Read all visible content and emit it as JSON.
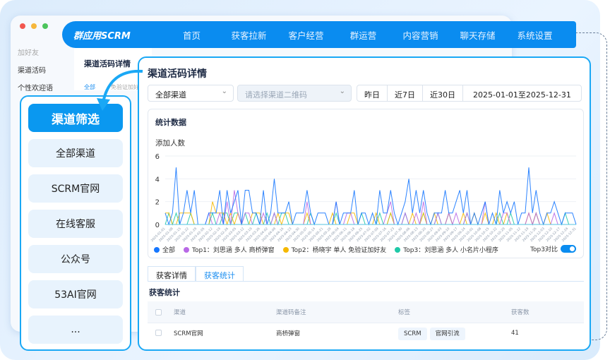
{
  "nav": {
    "logo": "群应用SCRM",
    "items": [
      "首页",
      "获客拉新",
      "客户经营",
      "群运营",
      "内容营销",
      "聊天存储",
      "系统设置"
    ]
  },
  "back": {
    "sidebar": [
      "加好友",
      "渠道活码",
      "个性欢迎语"
    ],
    "title": "渠道活码详情",
    "tab": "全部",
    "snippet": "免验证加好友"
  },
  "left_panel": {
    "items": [
      "渠道筛选",
      "全部渠道",
      "SCRM官网",
      "在线客服",
      "公众号",
      "53AI官网",
      "..."
    ]
  },
  "main": {
    "title": "渠道活码详情",
    "channel_select": "全部渠道",
    "qr_placeholder": "请选择渠道二维码",
    "quick_ranges": [
      "昨日",
      "近7日",
      "近30日"
    ],
    "date_range": "2025-01-01至2025-12-31",
    "card_title": "统计数据",
    "toggle_label": "Top3对比",
    "toggle_on": true,
    "tabs": [
      "获客详情",
      "获客统计"
    ],
    "active_tab": 1,
    "section_title": "获客统计",
    "table": {
      "headers": [
        "渠道",
        "渠道码备注",
        "标签",
        "获客数"
      ],
      "rows": [
        {
          "channel": "SCRM官网",
          "remark": "商桥弹窗",
          "tags": [
            "SCRM",
            "官网引流"
          ],
          "count": "41"
        }
      ]
    }
  },
  "chart_data": {
    "type": "line",
    "ylabel": "添加人数",
    "ylim": [
      0,
      6
    ],
    "yticks": [
      "0",
      "2",
      "4",
      "6"
    ],
    "x_start": "2025-01-01",
    "x_end": "2025-12-31",
    "xticks": [
      "2025-01-01",
      "2025-01-08",
      "2025-01-15",
      "2025-01-22",
      "2025-01-29",
      "2025-02-05",
      "2025-02-12",
      "2025-02-19",
      "2025-02-26",
      "2025-03-05",
      "2025-03-12",
      "2025-03-19",
      "2025-03-26",
      "2025-04-02",
      "2025-04-09",
      "2025-04-16",
      "2025-04-23",
      "2025-04-30",
      "2025-05-07",
      "2025-05-14",
      "2025-05-21",
      "2025-05-28",
      "2025-06-04",
      "2025-06-11",
      "2025-06-18",
      "2025-06-25",
      "2025-07-02",
      "2025-07-09",
      "2025-07-16",
      "2025-07-23",
      "2025-07-30",
      "2025-08-06",
      "2025-08-13",
      "2025-08-20",
      "2025-08-27",
      "2025-09-03",
      "2025-09-10",
      "2025-09-17",
      "2025-09-24",
      "2025-10-01",
      "2025-10-08",
      "2025-10-15",
      "2025-10-22",
      "2025-10-29",
      "2025-11-05",
      "2025-11-12",
      "2025-11-19",
      "2025-11-26",
      "2025-12-03",
      "2025-12-10",
      "2025-12-17",
      "2025-12-24",
      "2025-12-31"
    ],
    "series": [
      {
        "name": "全部",
        "color": "#1677ff",
        "values": [
          1,
          0,
          1,
          5,
          0,
          1,
          3,
          1,
          3,
          0,
          0,
          0,
          1,
          1,
          1,
          3,
          0,
          3,
          1,
          2,
          3,
          0,
          3,
          3,
          1,
          1,
          0,
          3,
          0,
          1,
          4,
          1,
          1,
          1,
          2,
          0,
          1,
          1,
          1,
          3,
          1,
          0,
          1,
          1,
          1,
          0,
          0,
          2,
          0,
          1,
          1,
          1,
          3,
          0,
          1,
          1,
          0,
          1,
          0,
          3,
          1,
          1,
          3,
          1,
          0,
          1,
          2,
          4,
          1,
          3,
          1,
          3,
          1,
          0,
          1,
          1,
          1,
          3,
          1,
          1,
          2,
          3,
          1,
          3,
          0,
          1,
          0,
          1,
          2,
          0,
          1,
          0,
          3,
          1,
          2,
          1,
          2,
          0,
          1,
          1,
          5,
          1,
          3,
          1,
          0,
          1,
          1,
          2,
          1,
          0,
          1,
          1,
          1,
          0
        ]
      },
      {
        "name": "Top1：刘思涵 多人 商桥弹窗",
        "color": "#b869e6",
        "values": [
          0,
          0,
          0,
          0,
          0,
          0,
          0,
          0,
          0,
          0,
          0,
          0,
          1,
          0,
          0,
          1,
          0,
          2,
          0,
          3,
          1,
          0,
          1,
          1,
          0,
          0,
          0,
          1,
          0,
          0,
          1,
          0,
          0,
          0,
          0,
          0,
          0,
          0,
          0,
          2,
          0,
          0,
          0,
          0,
          0,
          0,
          0,
          2,
          0,
          0,
          1,
          1,
          0,
          0,
          0,
          0,
          0,
          0,
          0,
          0,
          0,
          1,
          2,
          0,
          0,
          0,
          1,
          0,
          0,
          1,
          0,
          2,
          0,
          0,
          0,
          1,
          0,
          0,
          1,
          0,
          1,
          0,
          0,
          1,
          0,
          0,
          0,
          0,
          2,
          0,
          0,
          0,
          0,
          1,
          1,
          0,
          0,
          0,
          0,
          0,
          1,
          0,
          1,
          0,
          0,
          0,
          0,
          1,
          0,
          0,
          0,
          0,
          0,
          0
        ]
      },
      {
        "name": "Top2：杨晓宇 单人 免验证加好友",
        "color": "#f5b800",
        "values": [
          1,
          1,
          0,
          0,
          1,
          1,
          1,
          1,
          0,
          0,
          0,
          0,
          0,
          2,
          1,
          1,
          1,
          0,
          1,
          0,
          1,
          0,
          0,
          0,
          1,
          1,
          1,
          0,
          0,
          0,
          0,
          1,
          0,
          1,
          1,
          0,
          0,
          0,
          0,
          1,
          0,
          0,
          0,
          0,
          0,
          0,
          1,
          0,
          0,
          0,
          0,
          1,
          1,
          0,
          0,
          0,
          0,
          0,
          1,
          0,
          0,
          0,
          1,
          0,
          0,
          0,
          0,
          0,
          1,
          0,
          0,
          1,
          0,
          0,
          1,
          0,
          0,
          0,
          1,
          0,
          0,
          0,
          1,
          0,
          0,
          1,
          0,
          0,
          1,
          0,
          0,
          1,
          0,
          0,
          1,
          0,
          0,
          0,
          0,
          0,
          1,
          0,
          1,
          0,
          0,
          1,
          0,
          0,
          0,
          0,
          0,
          0,
          0,
          0
        ]
      },
      {
        "name": "Top3：刘思涵 多人 小名片小程序",
        "color": "#1fc9a8",
        "values": [
          0,
          1,
          0,
          1,
          0,
          0,
          0,
          1,
          0,
          0,
          0,
          0,
          0,
          1,
          0,
          0,
          1,
          1,
          0,
          1,
          1,
          0,
          1,
          0,
          0,
          1,
          0,
          0,
          1,
          0,
          1,
          0,
          1,
          1,
          0,
          0,
          0,
          0,
          0,
          0,
          1,
          0,
          0,
          0,
          0,
          0,
          0,
          1,
          0,
          0,
          0,
          0,
          0,
          0,
          1,
          0,
          0,
          0,
          0,
          1,
          0,
          0,
          1,
          0,
          0,
          0,
          1,
          0,
          0,
          0,
          0,
          1,
          0,
          0,
          0,
          1,
          0,
          0,
          1,
          0,
          0,
          0,
          0,
          1,
          0,
          0,
          0,
          0,
          0,
          0,
          0,
          0,
          1,
          0,
          0,
          1,
          0,
          0,
          0,
          0,
          0,
          0,
          1,
          0,
          0,
          0,
          0,
          0,
          0,
          0,
          1,
          0,
          0,
          0
        ]
      }
    ]
  }
}
